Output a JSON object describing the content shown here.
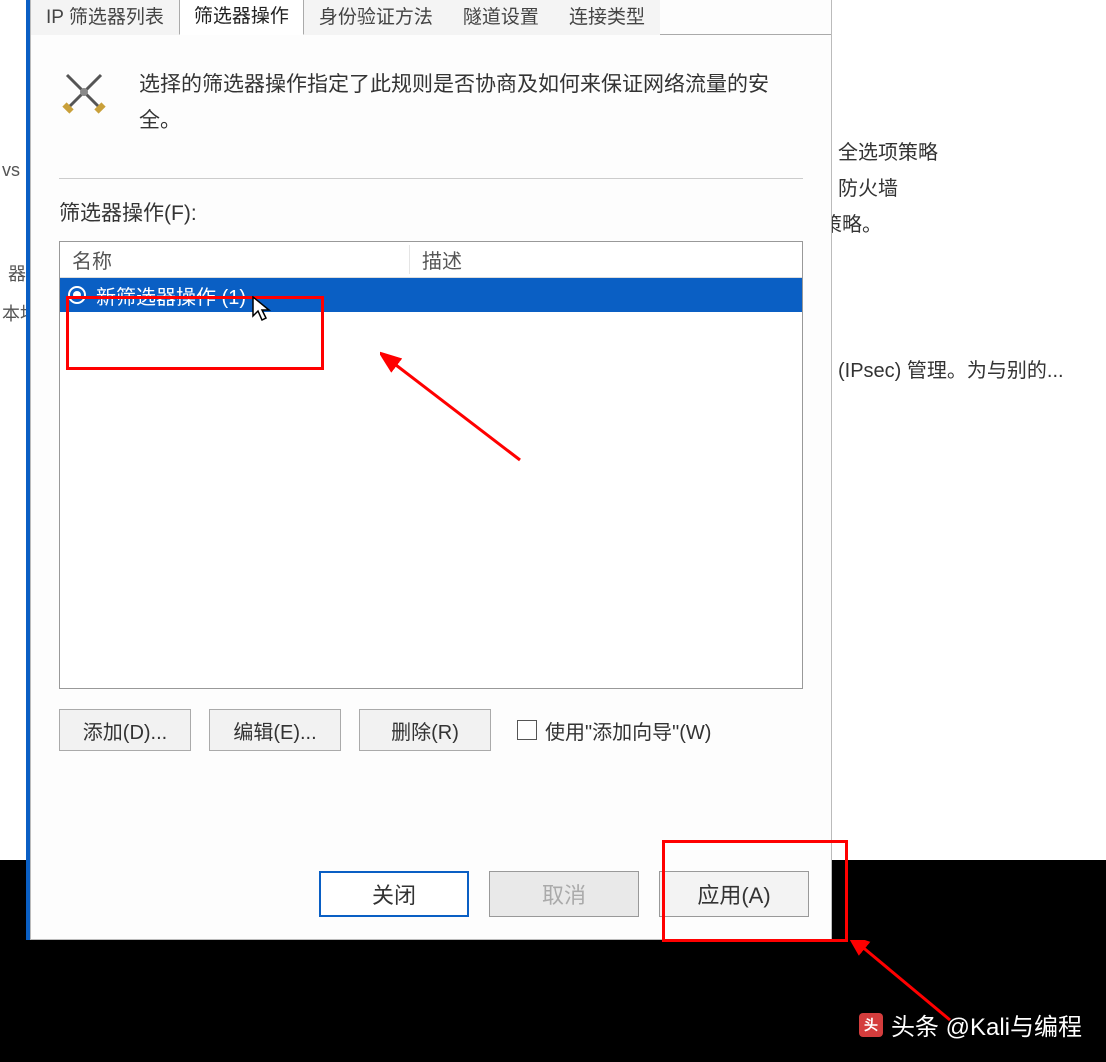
{
  "tabs": {
    "ip_filter_list": "IP 筛选器列表",
    "filter_action": "筛选器操作",
    "auth_method": "身份验证方法",
    "tunnel_settings": "隧道设置",
    "connection_type": "连接类型"
  },
  "description": "选择的筛选器操作指定了此规则是否协商及如何来保证网络流量的安全。",
  "section_label": "筛选器操作(F):",
  "columns": {
    "name": "名称",
    "description": "描述"
  },
  "list_items": [
    {
      "name": "新筛选器操作 (1)",
      "description": ""
    }
  ],
  "buttons": {
    "add": "添加(D)...",
    "edit": "编辑(E)...",
    "remove": "删除(R)",
    "wizard_checkbox": "使用\"添加向导\"(W)",
    "close": "关闭",
    "cancel": "取消",
    "apply": "应用(A)"
  },
  "background": {
    "text1": "全选项策略",
    "text2": "防火墙",
    "text3": "置组策略。",
    "text4": "(IPsec) 管理。为与别的...",
    "left1": "vs",
    "left2": "器",
    "left3": "本地"
  },
  "watermark": "头条 @Kali与编程"
}
